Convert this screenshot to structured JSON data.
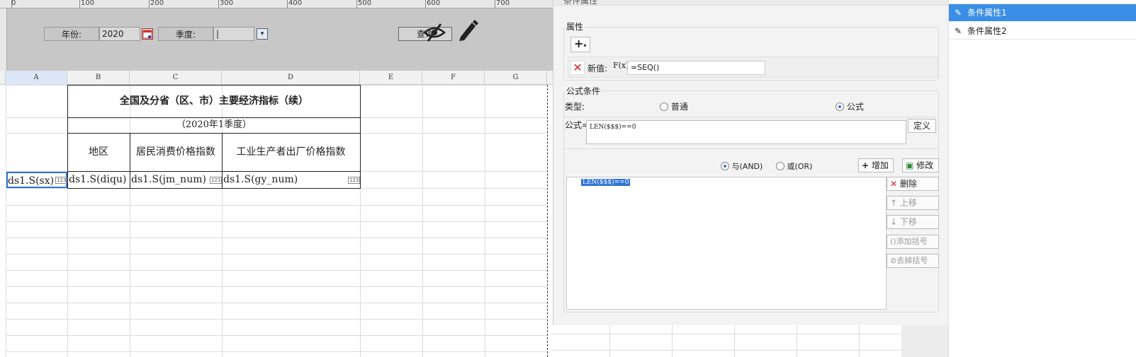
{
  "ruler": {
    "labels": [
      "0",
      "100",
      "200",
      "300",
      "400",
      "500",
      "600",
      "700"
    ]
  },
  "params": {
    "year_label": "年份:",
    "year_value": "2020",
    "quarter_label": "季度:",
    "quarter_value": "|",
    "query_label": "查询"
  },
  "columns": [
    "A",
    "B",
    "C",
    "D",
    "E",
    "F",
    "G"
  ],
  "report": {
    "title": "全国及分省（区、市）主要经济指标（续）",
    "subtitle": "（2020年1季度）",
    "headers": [
      "地区",
      "居民消费价格指数",
      "工业生产者出厂价格指数"
    ],
    "fields": [
      "ds1.S(sx)",
      "ds1.S(diqu)",
      "ds1.S(jm_num)",
      "ds1.S(gy_num)"
    ],
    "field_badge": "123"
  },
  "dialog": {
    "title": "条件属性",
    "attr_section": "属性",
    "add_symbol": "+",
    "new_value_label": "新值:",
    "fx_label": "F(x)",
    "new_value": "=SEQ()",
    "formula_section": "公式条件",
    "type_label": "类型:",
    "type_normal": "普通",
    "type_formula": "公式",
    "formula_label": "公式=",
    "formula_value": "LEN($$$)==0",
    "define_btn": "定义",
    "and_label": "与(AND)",
    "or_label": "或(OR)",
    "add_btn": "增加",
    "modify_btn": "修改",
    "delete_btn": "删除",
    "up_btn": "上移",
    "down_btn": "下移",
    "add_bracket_btn": "添加括号",
    "remove_bracket_btn": "去掉括号",
    "condition_item": "LEN($$$)==0"
  },
  "right_list": {
    "items": [
      "条件属性1",
      "条件属性2"
    ]
  },
  "colors": {
    "accent": "#3a8ee6",
    "selection": "#3a6fd0",
    "param_bg": "#c7c7c7"
  }
}
